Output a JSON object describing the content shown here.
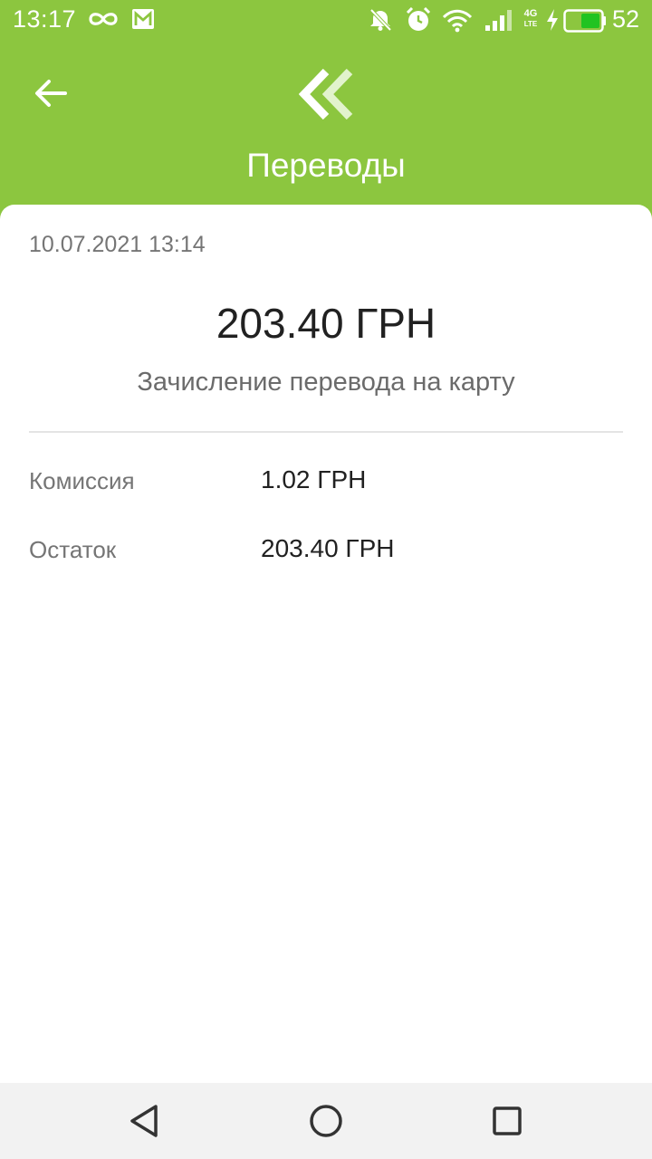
{
  "status_bar": {
    "time": "13:17",
    "battery_level": "52",
    "network_type": "4G",
    "icons": [
      "infinity-icon",
      "gmail-icon",
      "mute-icon",
      "alarm-icon",
      "wifi-icon",
      "signal-icon",
      "network-4g-lte-icon",
      "charging-icon",
      "battery-icon"
    ]
  },
  "header": {
    "title": "Переводы",
    "back_icon": "arrow-left-icon",
    "logo_icon": "double-chevron-left-icon",
    "background_color": "#8cc63f"
  },
  "transaction": {
    "datetime": "10.07.2021 13:14",
    "amount": "203.40 ГРН",
    "description": "Зачисление перевода на карту",
    "details": [
      {
        "label": "Комиссия",
        "value": "1.02 ГРН"
      },
      {
        "label": "Остаток",
        "value": "203.40 ГРН"
      }
    ]
  },
  "nav_bar": {
    "icons": [
      "back-triangle-icon",
      "home-circle-icon",
      "recents-square-icon"
    ]
  }
}
